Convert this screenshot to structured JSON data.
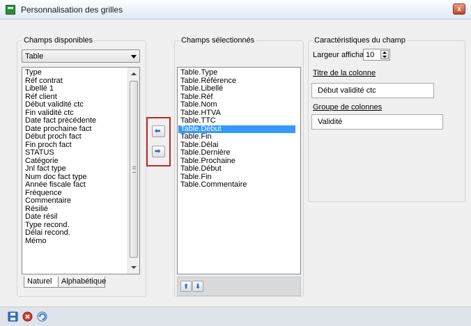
{
  "window": {
    "title": "Personnalisation des grilles",
    "close_label": "x"
  },
  "available": {
    "label": "Champs disponibles",
    "combo_value": "Table",
    "items": [
      "Type",
      "Réf contrat",
      "Libellé 1",
      "Réf client",
      "Début validité ctc",
      "Fin validité ctc",
      "Date fact précédente",
      "Date prochaine fact",
      "Début proch fact",
      "Fin proch fact",
      "STATUS",
      "Catégorie",
      "Jnl fact type",
      "Num doc fact type",
      "Année fiscale fact",
      "Fréquence",
      "Commentaire",
      "Résilié",
      "Date résil",
      "Type recond.",
      "Délai recond.",
      "Mémo"
    ],
    "tabs": [
      "Naturel",
      "Alphabétique"
    ]
  },
  "selected": {
    "label": "Champs sélectionnés",
    "items": [
      "Table.Type",
      "Table.Référence",
      "Table.Libellé",
      "Table.Réf",
      "Table.Nom",
      "Table.HTVA",
      "Table.TTC",
      "Table.Début",
      "Table.Fin",
      "Table.Délai",
      "Table.Dernière",
      "Table.Prochaine",
      "Table.Début",
      "Table.Fin",
      "Table.Commentaire"
    ],
    "selected_index": 7
  },
  "transfer": {
    "left_icon": "arrow-left-icon",
    "right_icon": "arrow-right-icon",
    "left_glyph": "⬅",
    "right_glyph": "➡"
  },
  "reorder": {
    "up_glyph": "⬆",
    "down_glyph": "⬇"
  },
  "properties": {
    "label": "Caractéristiques du champ",
    "width_label": "Largeur affichage",
    "width_value": "10",
    "column_title_label": "Titre de la colonne",
    "column_title_value": "Début validité ctc",
    "column_group_label": "Groupe de colonnes",
    "column_group_value": "Validité"
  },
  "colors": {
    "selection": "#3399ff",
    "highlight_border": "#c0272d",
    "arrow_blue": "#2f6bc5"
  }
}
